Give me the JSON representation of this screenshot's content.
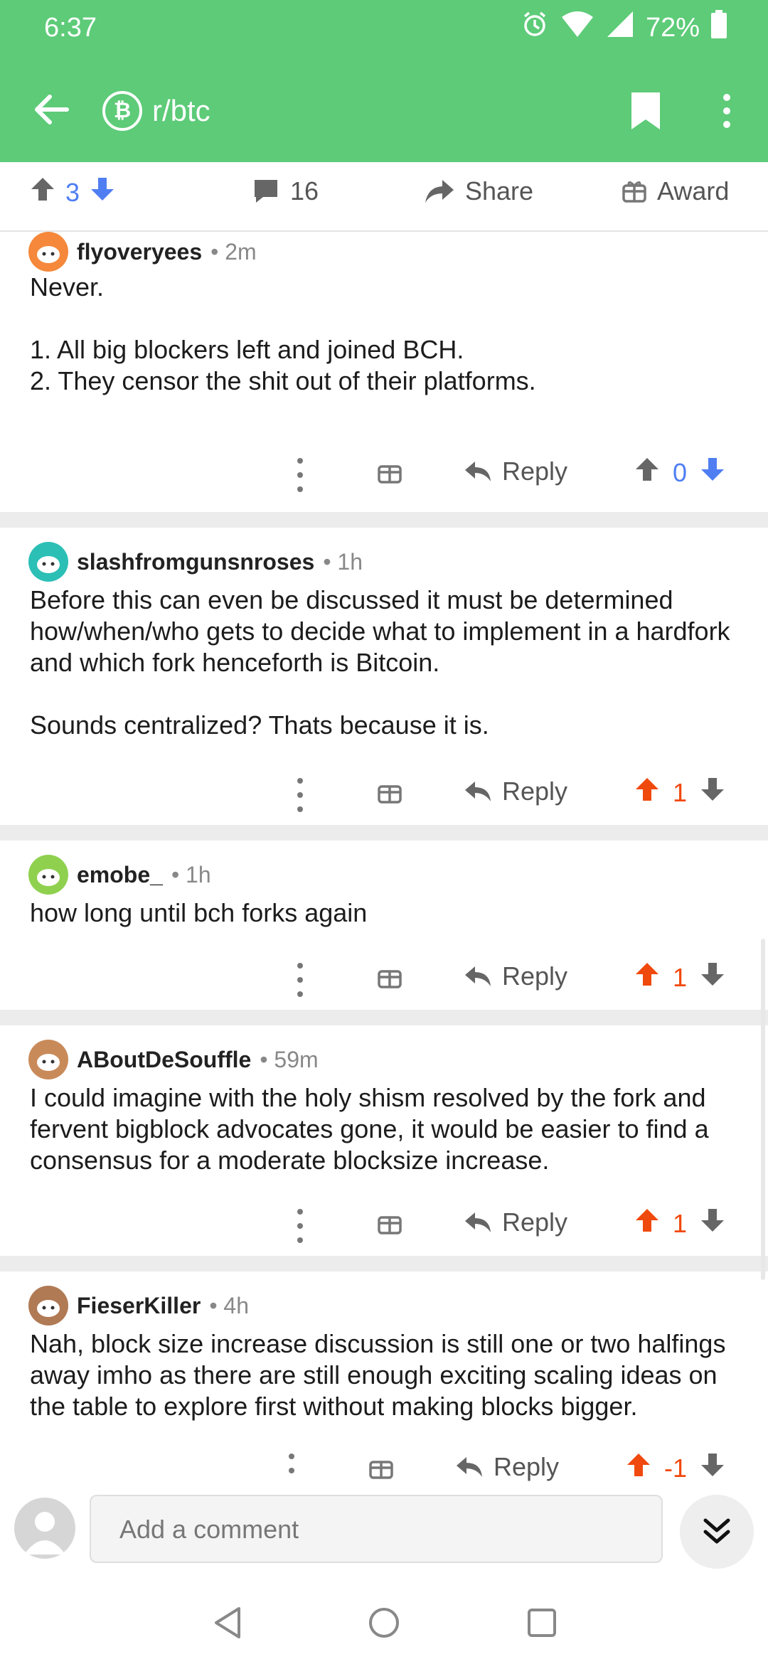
{
  "status_bar": {
    "time": "6:37",
    "battery": "72%"
  },
  "toolbar": {
    "subreddit": "r/btc",
    "sub_icon_letter": "₿"
  },
  "post_actions": {
    "score": "3",
    "comments": "16",
    "share": "Share",
    "award": "Award"
  },
  "comments": [
    {
      "author": "flyoveryees",
      "time": "• 2m",
      "body": "Never.\n\n1. All big blockers left and joined BCH.\n2. They censor the shit out of their platforms.",
      "reply": "Reply",
      "score": "0",
      "vote_state": "neutral",
      "avatar_color": "#f5883a"
    },
    {
      "author": "slashfromgunsnroses",
      "time": "• 1h",
      "body": "Before this can even be discussed it must be determined how/when/who gets to decide what to implement in a hardfork and which fork henceforth is Bitcoin.\n\nSounds centralized? Thats because it is.",
      "reply": "Reply",
      "score": "1",
      "vote_state": "up",
      "avatar_color": "#2bbfb6"
    },
    {
      "author": "emobe_",
      "time": "• 1h",
      "body": "how long until bch forks again",
      "reply": "Reply",
      "score": "1",
      "vote_state": "up",
      "avatar_color": "#8fd14f"
    },
    {
      "author": "ABoutDeSouffle",
      "time": "• 59m",
      "body": "I could imagine with the holy shism resolved by the fork and fervent bigblock advocates gone, it would be easier to find a consensus for a moderate blocksize increase.",
      "reply": "Reply",
      "score": "1",
      "vote_state": "up",
      "avatar_color": "#c98a5a"
    },
    {
      "author": "FieserKiller",
      "time": "• 4h",
      "body": "Nah, block size increase discussion is still one or two halfings away imho as there are still enough exciting scaling ideas on the table to explore first without making blocks bigger.",
      "reply": "Reply",
      "score": "-1",
      "vote_state": "up",
      "avatar_color": "#b07a54"
    }
  ],
  "composer": {
    "placeholder": "Add a comment"
  },
  "colors": {
    "accent": "#5dcb78",
    "upvote": "#f0490d",
    "downvote": "#4f7ef2"
  }
}
